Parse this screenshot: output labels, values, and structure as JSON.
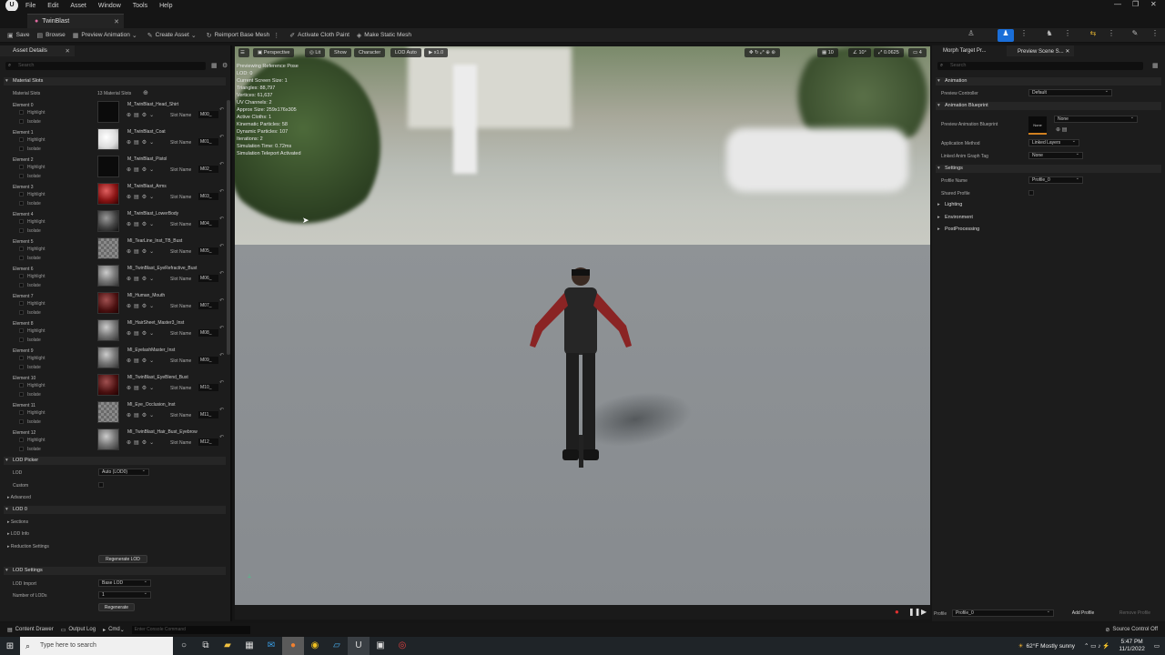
{
  "menu": {
    "items": [
      "File",
      "Edit",
      "Asset",
      "Window",
      "Tools",
      "Help"
    ]
  },
  "tab": {
    "title": "TwinBlast"
  },
  "toolbar": {
    "save": "Save",
    "browse": "Browse",
    "preview_animation": "Preview Animation",
    "create_asset": "Create Asset",
    "reimport": "Reimport Base Mesh",
    "cloth_paint": "Activate Cloth Paint",
    "make_static": "Make Static Mesh"
  },
  "left_panel": {
    "tab": "Asset Details",
    "search_placeholder": "Search",
    "material_slots_section": "Material Slots",
    "material_slots_label": "Material Slots",
    "material_slots_count": "13 Material Slots",
    "highlight": "Highlight",
    "isolate": "Isolate",
    "slot_name_label": "Slot Name",
    "elements": [
      {
        "name": "Element 0",
        "material": "M_TwinBlast_Head_Shirt",
        "slot": "M00_",
        "thumb": "black"
      },
      {
        "name": "Element 1",
        "material": "M_TwinBlast_Coat",
        "slot": "M01_",
        "thumb": "white"
      },
      {
        "name": "Element 2",
        "material": "M_TwinBlast_Pistol",
        "slot": "M02_",
        "thumb": "black"
      },
      {
        "name": "Element 3",
        "material": "M_TwinBlast_Arms",
        "slot": "M03_",
        "thumb": "red"
      },
      {
        "name": "Element 4",
        "material": "M_TwinBlast_LowerBody",
        "slot": "M04_",
        "thumb": "dark"
      },
      {
        "name": "Element 5",
        "material": "MI_TearLine_Inst_TB_Bust",
        "slot": "M05_",
        "thumb": "check"
      },
      {
        "name": "Element 6",
        "material": "MI_TwinBlast_EyeRefractive_Bust",
        "slot": "M06_",
        "thumb": "hair"
      },
      {
        "name": "Element 7",
        "material": "MI_Human_Mouth",
        "slot": "M07_",
        "thumb": "blood"
      },
      {
        "name": "Element 8",
        "material": "MI_HairSheet_Master3_Inst",
        "slot": "M08_",
        "thumb": "hair"
      },
      {
        "name": "Element 9",
        "material": "MI_EyelashMaster_Inst",
        "slot": "M09_",
        "thumb": "hair"
      },
      {
        "name": "Element 10",
        "material": "MI_TwinBlast_EyeBlend_Bust",
        "slot": "M10_",
        "thumb": "blood"
      },
      {
        "name": "Element 11",
        "material": "MI_Eye_Occlusion_Inst",
        "slot": "M11_",
        "thumb": "check"
      },
      {
        "name": "Element 12",
        "material": "MI_TwinBlast_Hair_Bust_Eyebrow",
        "slot": "M12_",
        "thumb": "hair"
      }
    ],
    "lod_picker_section": "LOD Picker",
    "lod_label": "LOD",
    "lod_value": "Auto (LOD0)",
    "custom_label": "Custom",
    "advanced": "Advanced",
    "lod0_section": "LOD 0",
    "sections": "Sections",
    "lod_info": "LOD Info",
    "reduction_settings": "Reduction Settings",
    "regenerate_lod": "Regenerate LOD",
    "lod_settings_section": "LOD Settings",
    "lod_import_label": "LOD Import",
    "lod_import_value": "Base LOD",
    "num_lods_label": "Number of LODs",
    "num_lods_value": "1",
    "regenerate": "Regenerate"
  },
  "viewport": {
    "perspective": "Perspective",
    "lit": "Lit",
    "show": "Show",
    "character": "Character",
    "lod_auto": "LOD Auto",
    "speed": "x1.0",
    "grid_value": "10",
    "angle_value": "10°",
    "scale_value": "0.0625",
    "cam_value": "4",
    "stats": [
      "Previewing Reference Pose",
      "LOD: 0",
      "Current Screen Size: 1",
      "Triangles: 88,797",
      "Vertices: 61,637",
      "UV Channels: 2",
      "Approx Size: 259x176x305",
      "Active Cloths: 1",
      "Kinematic Particles: 58",
      "Dynamic Particles: 107",
      "Iterations: 2",
      "Simulation Time: 0.72ms",
      "Simulation Teleport Activated"
    ]
  },
  "right_panel": {
    "tab1": "Morph Target Pr...",
    "tab2": "Preview Scene S...",
    "search_placeholder": "Search",
    "animation_section": "Animation",
    "preview_controller_label": "Preview Controller",
    "preview_controller_value": "Default",
    "anim_bp_section": "Animation Blueprint",
    "preview_anim_bp_label": "Preview Animation Blueprint",
    "none_thumb": "None",
    "none_value": "None",
    "application_method_label": "Application Method",
    "application_method_value": "Linked Layers",
    "linked_tag_label": "Linked Anim Graph Tag",
    "linked_tag_value": "None",
    "settings_section": "Settings",
    "profile_name_label": "Profile Name",
    "profile_name_value": "Profile_0",
    "shared_profile_label": "Shared Profile",
    "lighting": "Lighting",
    "environment": "Environment",
    "postprocessing": "PostProcessing",
    "profile_label": "Profile",
    "profile_value": "Profile_0",
    "add_profile": "Add Profile",
    "remove_profile": "Remove Profile"
  },
  "bottom_bar": {
    "content_drawer": "Content Drawer",
    "output_log": "Output Log",
    "cmd": "Cmd",
    "console_placeholder": "Enter Console Command",
    "source_control": "Source Control Off"
  },
  "taskbar": {
    "search_placeholder": "Type here to search",
    "weather": "62°F  Mostly sunny",
    "time": "5:47 PM",
    "date": "11/1/2022"
  }
}
